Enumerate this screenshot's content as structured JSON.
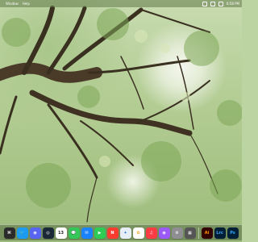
{
  "menubar": {
    "app_menus": [
      "Window",
      "Help"
    ],
    "clock": "6:58 PM"
  },
  "dock": {
    "items": [
      {
        "name": "launchpad",
        "label": "",
        "bg": "#2a2a2a",
        "fg": "#ffffff",
        "glyph": "⌘"
      },
      {
        "name": "twitter",
        "label": "",
        "bg": "#1d9bf0",
        "fg": "#ffffff",
        "glyph": "🐦"
      },
      {
        "name": "discord",
        "label": "",
        "bg": "#5865f2",
        "fg": "#ffffff",
        "glyph": "◉"
      },
      {
        "name": "steam",
        "label": "",
        "bg": "#1b2838",
        "fg": "#ffffff",
        "glyph": "◎"
      },
      {
        "name": "calendar",
        "label": "13",
        "bg": "#ffffff",
        "fg": "#222222",
        "glyph": ""
      },
      {
        "name": "messages",
        "label": "",
        "bg": "#34c759",
        "fg": "#ffffff",
        "glyph": "💬"
      },
      {
        "name": "mail",
        "label": "",
        "bg": "#1a82fb",
        "fg": "#ffffff",
        "glyph": "✉"
      },
      {
        "name": "facetime",
        "label": "",
        "bg": "#2ecc55",
        "fg": "#ffffff",
        "glyph": "▶"
      },
      {
        "name": "news",
        "label": "",
        "bg": "#ff3b30",
        "fg": "#ffffff",
        "glyph": "N"
      },
      {
        "name": "safari",
        "label": "",
        "bg": "#e8eef7",
        "fg": "#1a6ee0",
        "glyph": "✦"
      },
      {
        "name": "photos",
        "label": "",
        "bg": "#ffffff",
        "fg": "#f39c12",
        "glyph": "✿"
      },
      {
        "name": "music",
        "label": "",
        "bg": "#fc3c44",
        "fg": "#ffffff",
        "glyph": "♫"
      },
      {
        "name": "podcasts",
        "label": "",
        "bg": "#9b59f6",
        "fg": "#ffffff",
        "glyph": "◉"
      },
      {
        "name": "system-settings",
        "label": "",
        "bg": "#8e8e93",
        "fg": "#ffffff",
        "glyph": "⚙"
      },
      {
        "name": "files",
        "label": "",
        "bg": "#555555",
        "fg": "#ffffff",
        "glyph": "▦"
      },
      {
        "name": "illustrator",
        "label": "Ai",
        "bg": "#330000",
        "fg": "#ff9a00",
        "glyph": ""
      },
      {
        "name": "lightroom-classic",
        "label": "Lrc",
        "bg": "#001e36",
        "fg": "#31a8ff",
        "glyph": ""
      },
      {
        "name": "photoshop",
        "label": "Ps",
        "bg": "#001e36",
        "fg": "#31a8ff",
        "glyph": ""
      }
    ]
  }
}
